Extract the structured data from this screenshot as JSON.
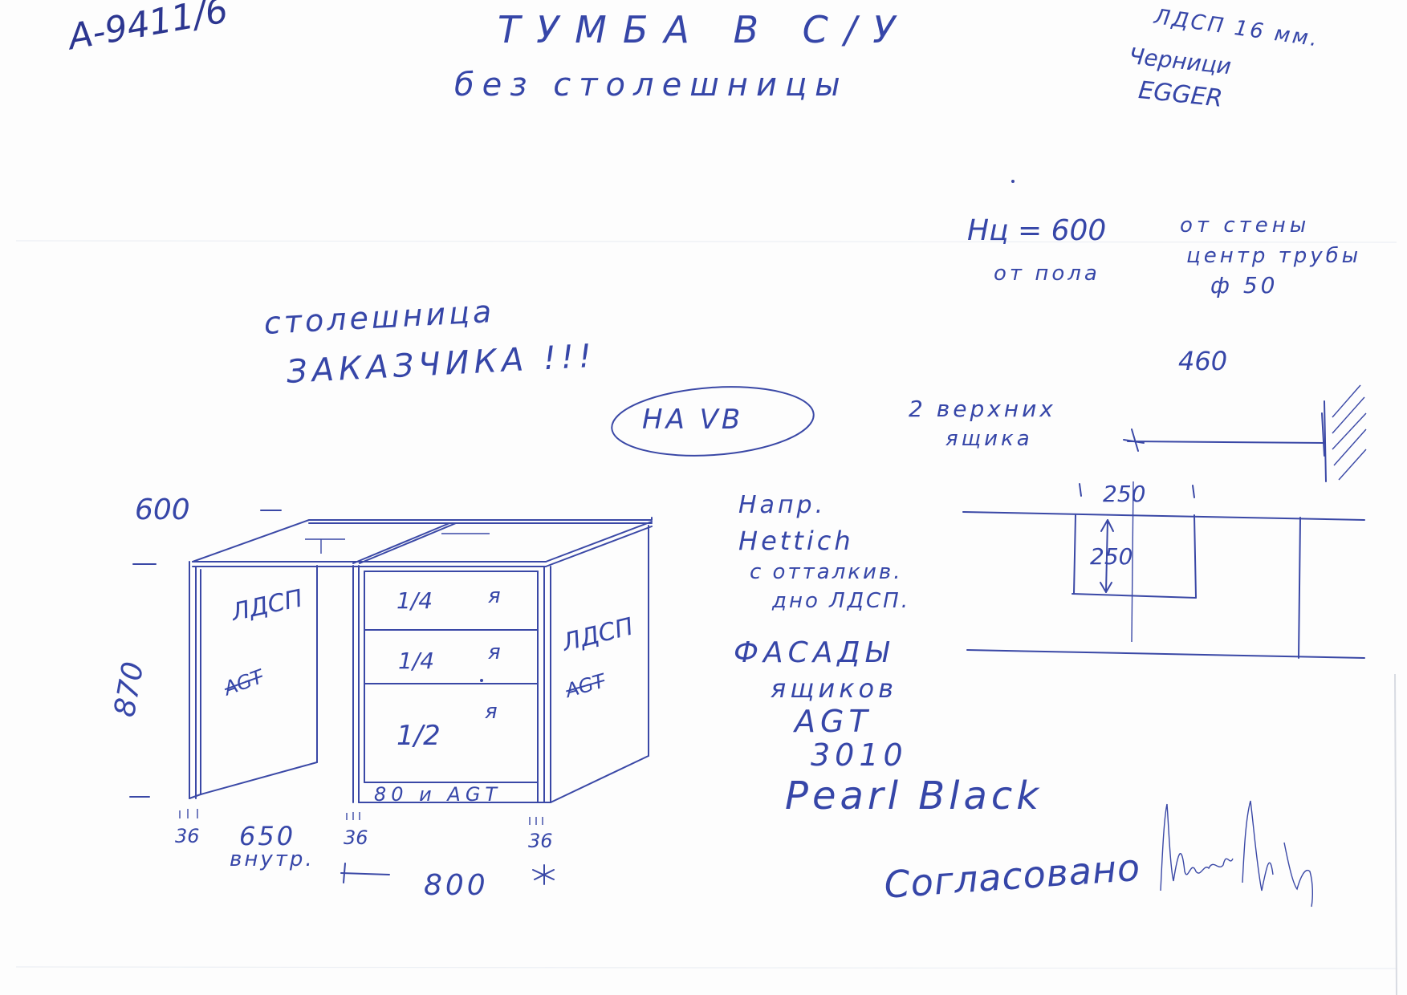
{
  "doc_code": "А-9411/6",
  "title": "ТУМБА В С/У",
  "subtitle": "без столешницы",
  "material": {
    "line1": "ЛДСП 16 мм.",
    "line2": "Черници",
    "line3": "EGGER"
  },
  "height_note": {
    "label": "Нц = 600",
    "sub": "от пола"
  },
  "wall_note": {
    "line1": "от стены",
    "line2": "центр трубы",
    "line3": "ф 50"
  },
  "countertop_note": {
    "line1": "столешница",
    "line2": "ЗАКАЗЧИКА !!!"
  },
  "vb_note": "НА VB",
  "drawers_note": {
    "line1": "2 верхних",
    "line2": "ящика"
  },
  "hetich_note": {
    "line1": "Напр.",
    "line2": "Hettich",
    "line3": "с отталкив.",
    "line4": "дно ЛДСП."
  },
  "facade_note": {
    "line1": "ФАСАДЫ",
    "line2": "ящиков",
    "line3": "AGT",
    "line4": "3010",
    "line5": "Pearl Black"
  },
  "plan": {
    "dim_460": "460",
    "dim_250_w": "250",
    "dim_250_h": "250"
  },
  "cabinet": {
    "depth": "600",
    "height": "870",
    "left_panel": "ЛДСП",
    "left_panel_sub": "AGT",
    "right_panel": "ЛДСП",
    "right_panel_sub": "AGT",
    "drawers": [
      {
        "frac": "1/4",
        "mark": "я"
      },
      {
        "frac": "1/4",
        "mark": "я"
      },
      {
        "frac": "1/2",
        "mark": "я"
      }
    ],
    "plinth": "80 и AGT",
    "dim_36_left": "36",
    "dim_650": "650",
    "dim_650_sub": "внутр.",
    "dim_36_mid": "36",
    "dim_36_right": "36",
    "dim_800": "800"
  },
  "approval": "Согласовано"
}
